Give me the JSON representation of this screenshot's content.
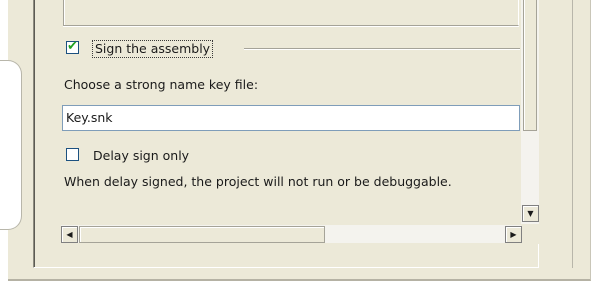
{
  "signing": {
    "sign_assembly_label": "Sign the assembly",
    "sign_assembly_checked": true,
    "choose_key_label": "Choose a strong name key file:",
    "key_file_value": "Key.snk",
    "delay_sign_label": "Delay sign only",
    "delay_sign_checked": false,
    "delay_info_text": "When delay signed, the project will not run or be debuggable."
  },
  "scrollbars": {
    "down_arrow": "▼",
    "left_arrow": "◀",
    "right_arrow": "▶"
  },
  "icons": {
    "checkmark": "✔"
  }
}
